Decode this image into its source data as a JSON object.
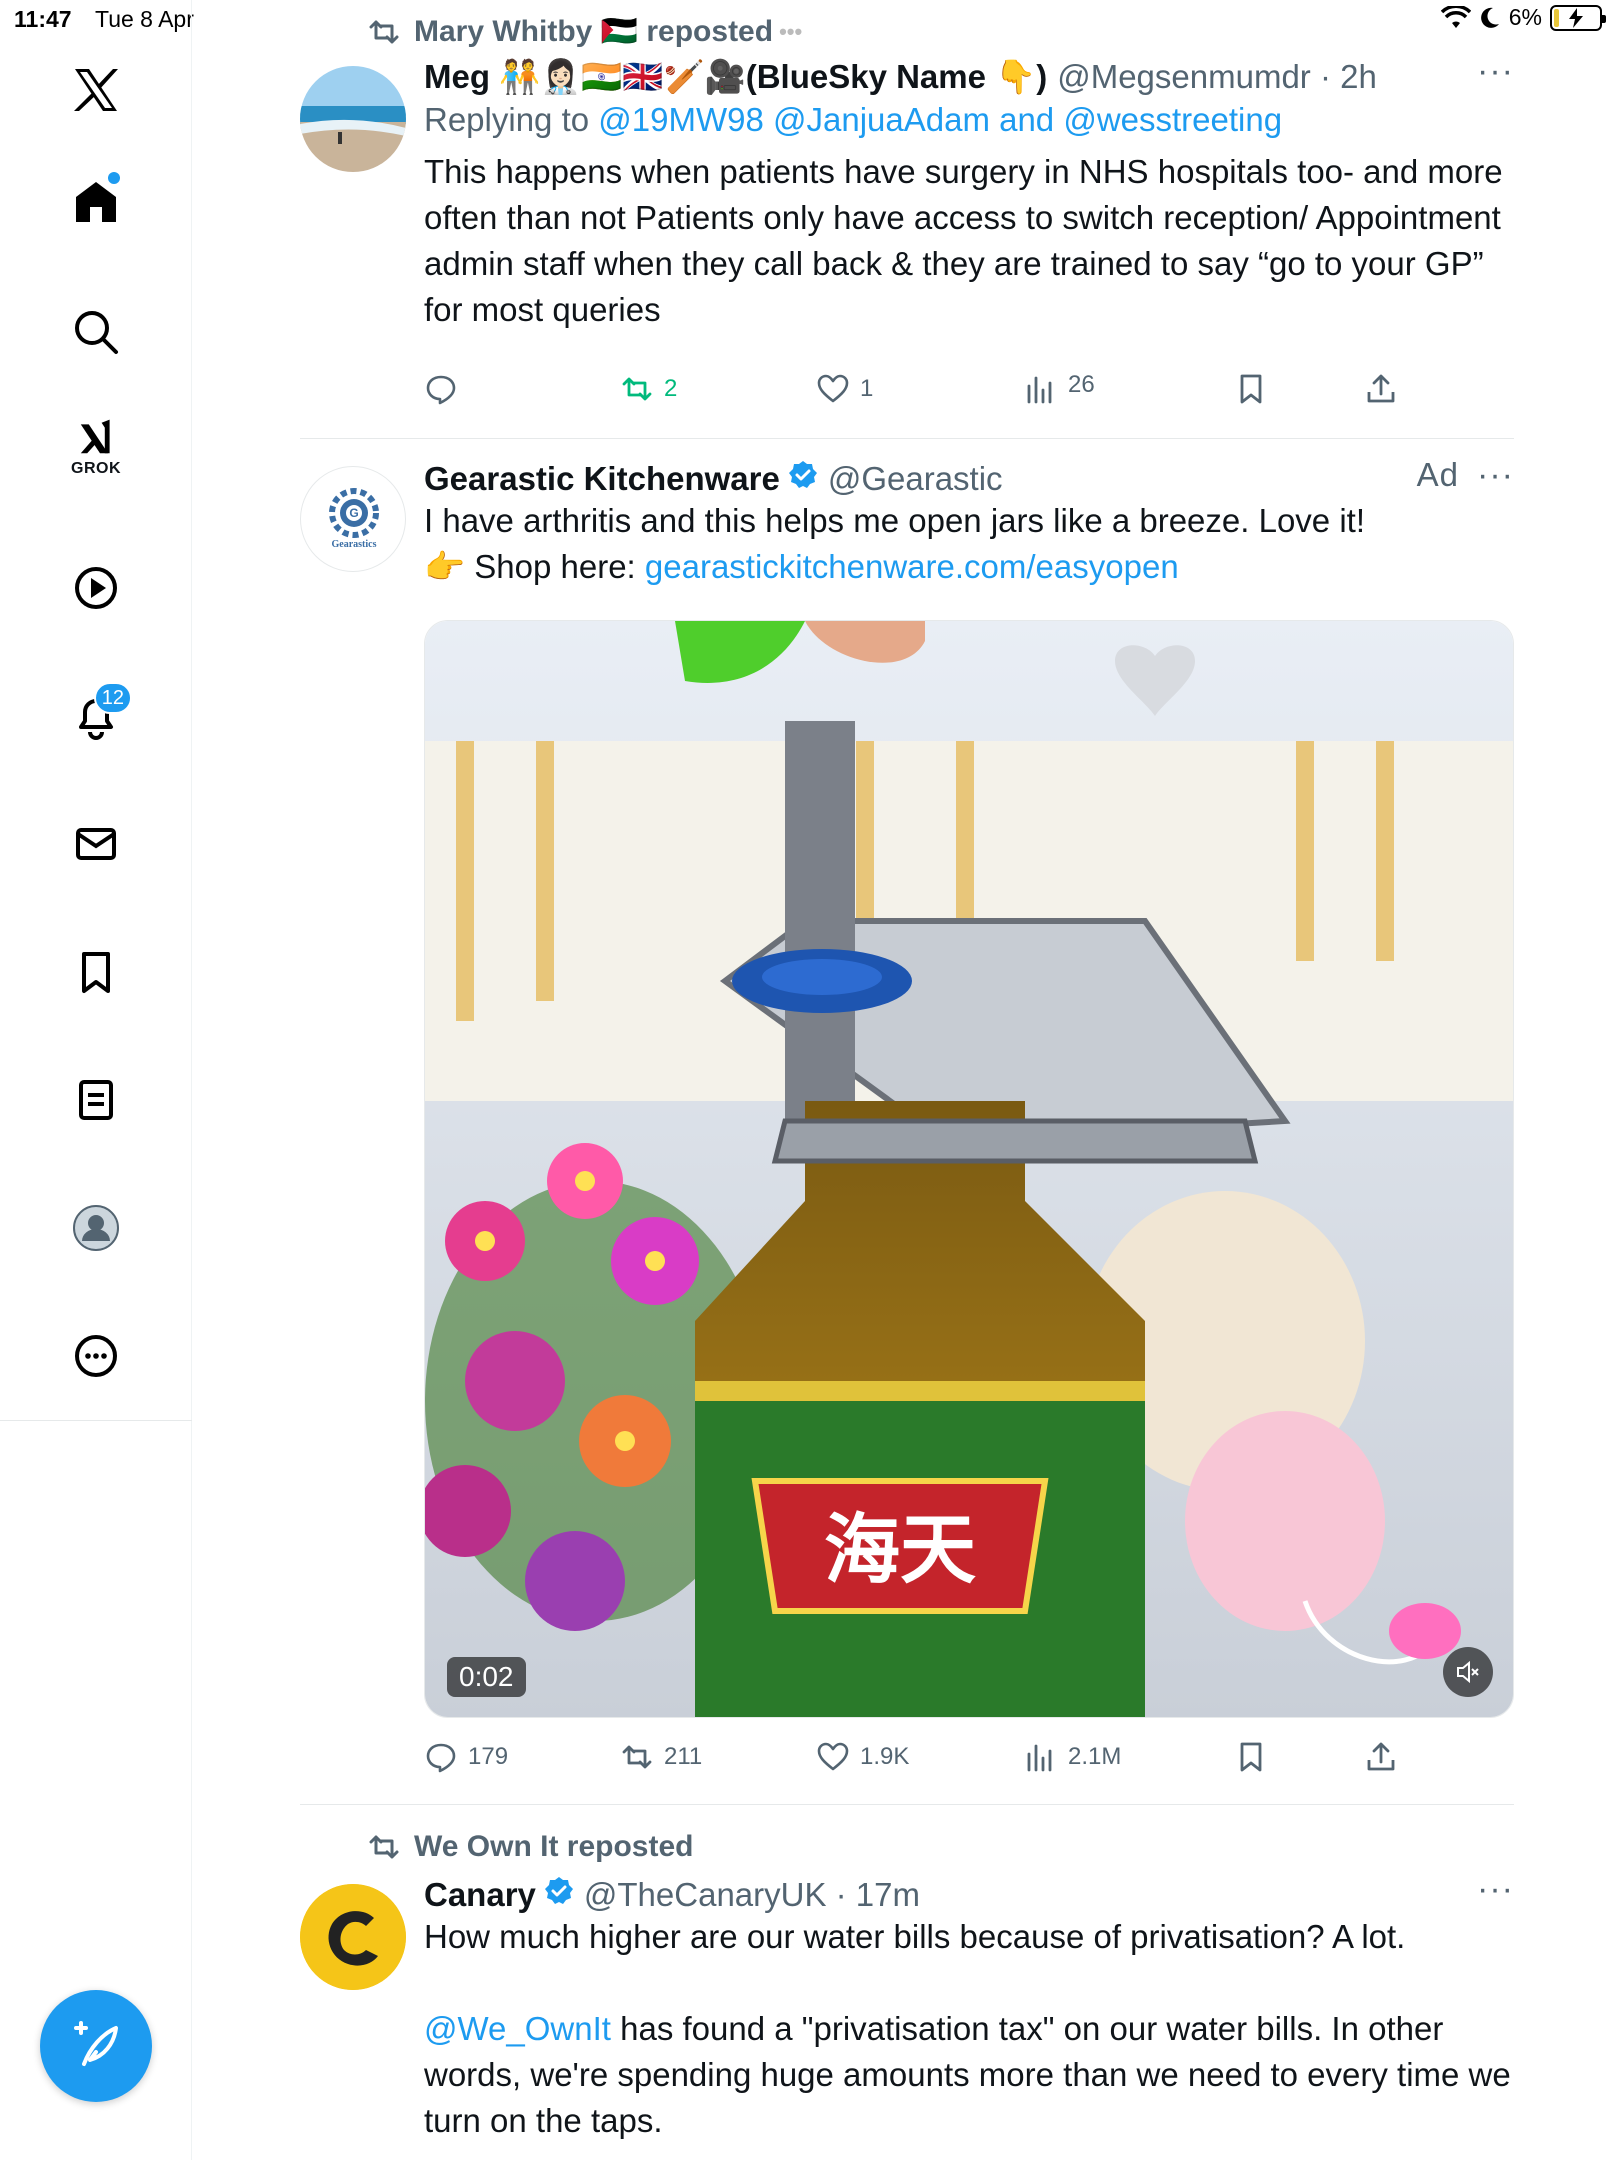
{
  "status_bar": {
    "time": "11:47",
    "date": "Tue 8 Apr",
    "battery": "6%"
  },
  "sidebar": {
    "grok_label": "GROK",
    "notification_count": "12"
  },
  "tweets": [
    {
      "repost_by": "Mary Whitby 🇵🇸 reposted",
      "name": "Meg 🧑‍🤝‍🧑👩🏻‍⚕️🇮🇳🇬🇧🏏🎥(BlueSky Name 👇)",
      "handle": "@Megsenmumdr · 2h",
      "replying_prefix": "Replying to ",
      "replying_to": "@19MW98 @JanjuaAdam and @wesstreeting",
      "text": "This happens when patients have surgery in NHS hospitals too- and more often than not Patients only have access to switch reception/ Appointment admin staff when they call back & they are trained to say “go to your GP” for most queries",
      "stats": {
        "replies": "",
        "reposts": "2",
        "likes": "1",
        "views": "26"
      }
    },
    {
      "name": "Gearastic Kitchenware",
      "handle": "@Gearastic",
      "ad_label": "Ad",
      "avatar_text": "Gearastics",
      "text_line1": "I have arthritis and this helps me open jars like a breeze. Love it!",
      "shop_prefix": "👉 Shop here: ",
      "shop_link": "gearastickitchenware.com/easyopen",
      "video_time": "0:02",
      "bottle_label": "海天",
      "stats": {
        "replies": "179",
        "reposts": "211",
        "likes": "1.9K",
        "views": "2.1M"
      }
    },
    {
      "repost_by": "We Own It reposted",
      "name": "Canary",
      "handle": "@TheCanaryUK · 17m",
      "text_line1": "How much higher are our water bills because of privatisation? A lot.",
      "mention": "@We_OwnIt",
      "text_line2": " has found a \"privatisation tax\" on our water bills. In other words, we're spending huge amounts more than we need to every time we turn on the taps."
    }
  ],
  "colors": {
    "accent": "#1d9bf0",
    "repost_green": "#00ba7c",
    "secondary_text": "#536471"
  }
}
